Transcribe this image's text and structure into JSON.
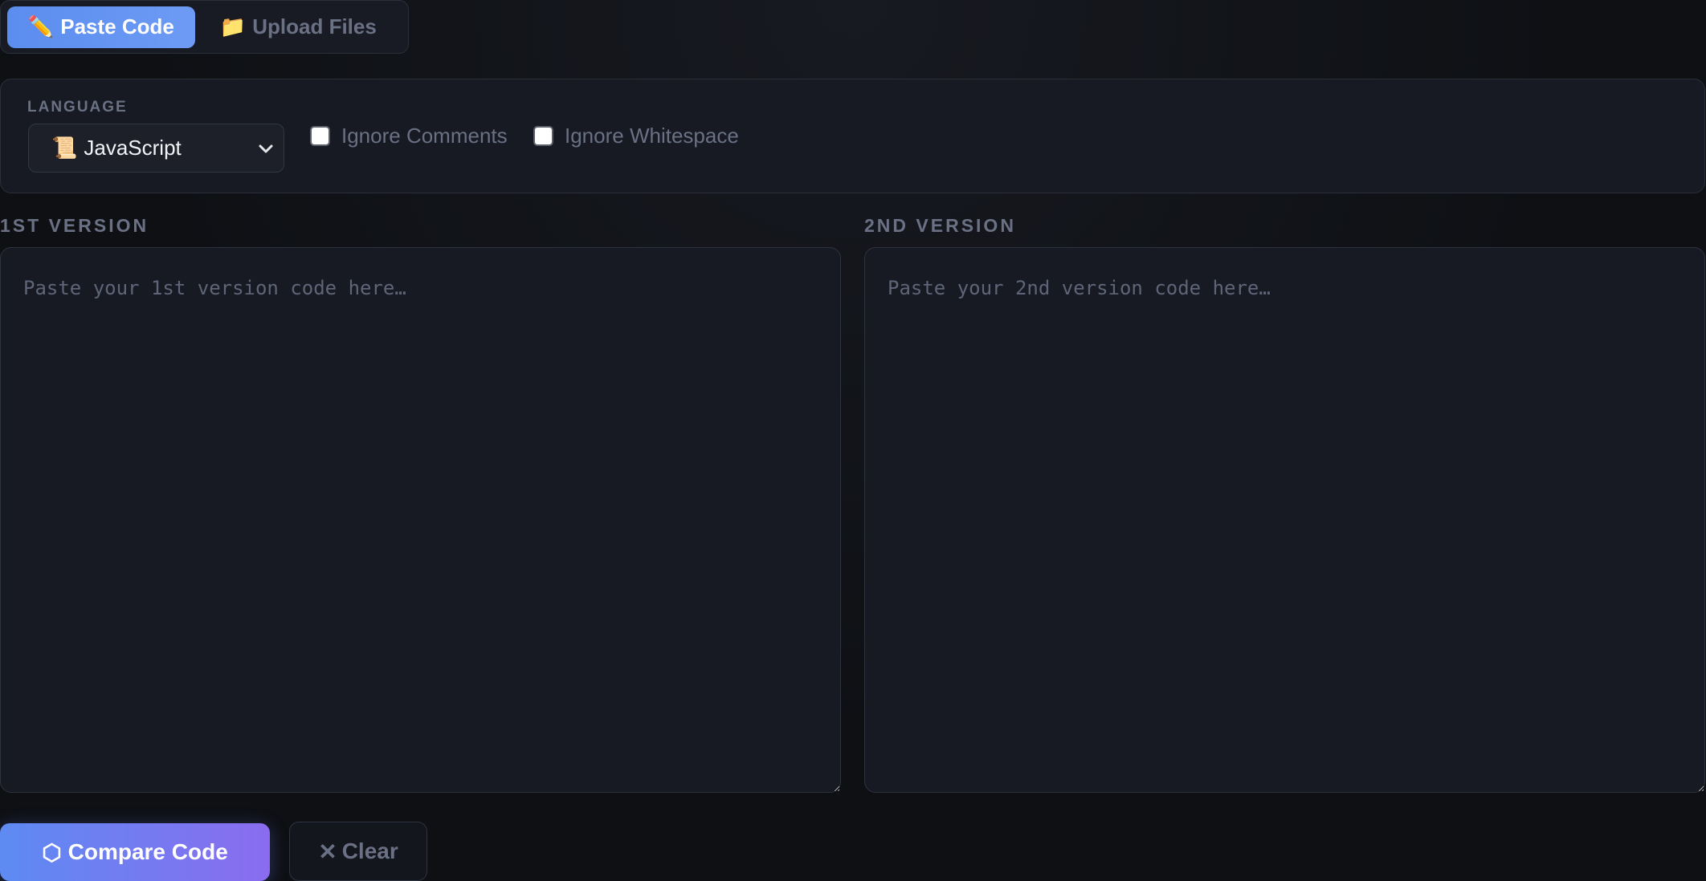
{
  "mode_tabs": {
    "paste": {
      "icon": "pencil-icon",
      "emoji": "✏️",
      "label": "Paste Code"
    },
    "upload": {
      "icon": "folder-icon",
      "emoji": "📁",
      "label": "Upload Files"
    }
  },
  "options": {
    "language_label": "LANGUAGE",
    "language": {
      "icon": "scroll-icon",
      "emoji": "📜",
      "value": "JavaScript"
    },
    "ignore_comments_label": "Ignore Comments",
    "ignore_whitespace_label": "Ignore Whitespace"
  },
  "editors": {
    "first": {
      "label": "1ST VERSION",
      "placeholder": "Paste your 1st version code here…"
    },
    "second": {
      "label": "2ND VERSION",
      "placeholder": "Paste your 2nd version code here…"
    }
  },
  "actions": {
    "compare_icon": "⬡",
    "compare_label": "Compare Code",
    "clear_icon": "✕",
    "clear_label": "Clear"
  },
  "colors": {
    "accent_start": "#5b8def",
    "accent_end": "#8a6cf0",
    "background": "#0e1014",
    "panel": "#171a22",
    "muted_text": "#6b7185"
  }
}
